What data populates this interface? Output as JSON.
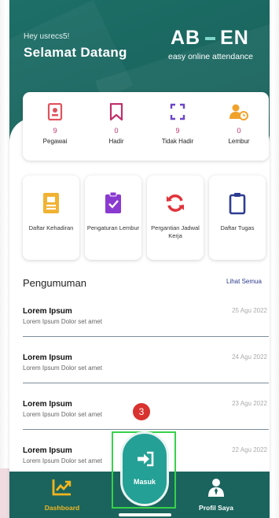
{
  "header": {
    "greeting_small": "Hey usrecs5!",
    "greeting_big": "Selamat Datang",
    "brand_left": "AB",
    "brand_right": "EN",
    "tagline": "easy online attendance"
  },
  "stats": [
    {
      "value": "9",
      "label": "Pegawai",
      "icon": "id-badge-icon",
      "color": "#e0525c"
    },
    {
      "value": "0",
      "label": "Hadir",
      "icon": "bookmark-icon",
      "color": "#c0306b"
    },
    {
      "value": "9",
      "label": "Tidak Hadir",
      "icon": "scan-frame-icon",
      "color": "#6b45c8"
    },
    {
      "value": "0",
      "label": "Lembur",
      "icon": "user-clock-icon",
      "color": "#f0a22b"
    }
  ],
  "menu": [
    {
      "label": "Daftar Kehadiran",
      "icon": "id-card-icon",
      "color": "#f1b233"
    },
    {
      "label": "Pengaturan Lembur",
      "icon": "clipboard-check-icon",
      "color": "#8a3ad0"
    },
    {
      "label": "Pergantian Jadwal Kerja",
      "icon": "refresh-icon",
      "color": "#e0343b"
    },
    {
      "label": "Daftar Tugas",
      "icon": "clipboard-icon",
      "color": "#2e3d92"
    }
  ],
  "announcements": {
    "title": "Pengumuman",
    "see_all": "Lihat Semua",
    "items": [
      {
        "title": "Lorem Ipsum",
        "desc": "Lorem Ipsum Dolor set amet",
        "date": "25 Agu 2022"
      },
      {
        "title": "Lorem Ipsum",
        "desc": "Lorem Ipsum Dolor set amet",
        "date": "24 Agu 2022"
      },
      {
        "title": "Lorem Ipsum",
        "desc": "Lorem Ipsum Dolor set amet",
        "date": "23 Agu 2022"
      },
      {
        "title": "Lorem Ipsum",
        "desc": "Lorem Ipsum Dolor set amet",
        "date": "22 Agu 2022"
      }
    ]
  },
  "nav": {
    "dashboard": "Dashboard",
    "masuk": "Masuk",
    "profile": "Profil Saya",
    "active_color": "#f2b51f"
  },
  "badge": "3"
}
